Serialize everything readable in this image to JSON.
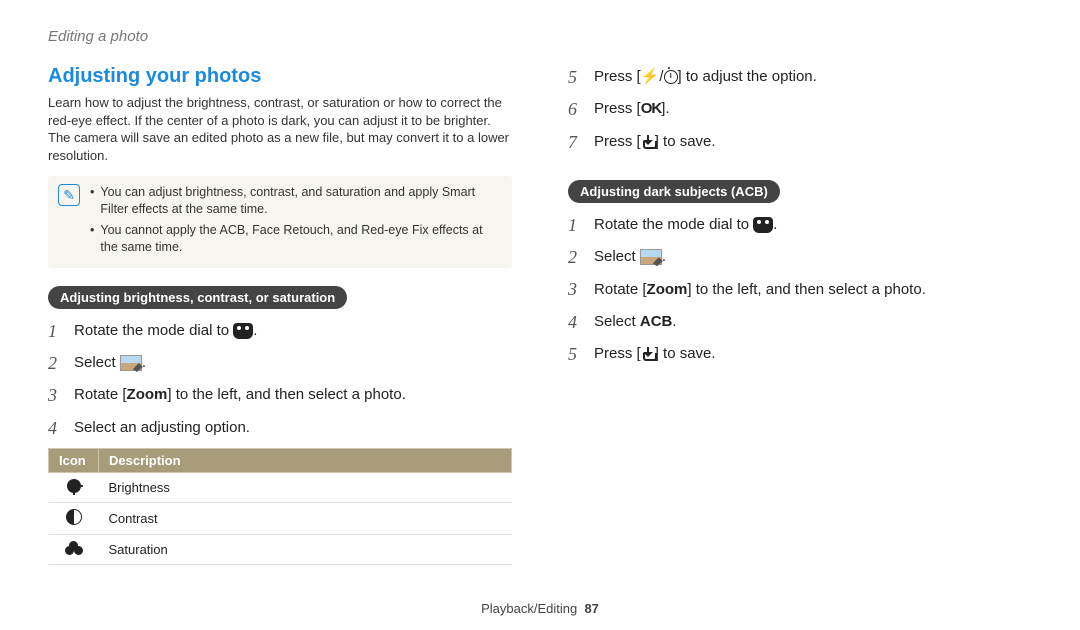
{
  "breadcrumb": "Editing a photo",
  "left": {
    "title": "Adjusting your photos",
    "intro": "Learn how to adjust the brightness, contrast, or saturation or how to correct the red-eye effect. If the center of a photo is dark, you can adjust it to be brighter. The camera will save an edited photo as a new file, but may convert it to a lower resolution.",
    "note1": "You can adjust brightness, contrast, and saturation and apply Smart Filter effects at the same time.",
    "note2": "You cannot apply the ACB, Face Retouch, and Red-eye Fix effects at the same time.",
    "pill": "Adjusting brightness, contrast, or saturation",
    "steps": {
      "s1a": "Rotate the mode dial to ",
      "s1b": ".",
      "s2a": "Select ",
      "s2b": ".",
      "s3a": "Rotate [",
      "s3b": "Zoom",
      "s3c": "] to the left, and then select a photo.",
      "s4": "Select an adjusting option."
    },
    "table": {
      "h1": "Icon",
      "h2": "Description",
      "r1": "Brightness",
      "r2": "Contrast",
      "r3": "Saturation"
    }
  },
  "right": {
    "steps_top": {
      "s5a": "Press [",
      "s5b": "/",
      "s5c": "] to adjust the option.",
      "s6a": "Press [",
      "s6b": "].",
      "s7a": "Press [",
      "s7b": "] to save."
    },
    "pill": "Adjusting dark subjects (ACB)",
    "steps_acb": {
      "s1a": "Rotate the mode dial to ",
      "s1b": ".",
      "s2a": "Select ",
      "s2b": ".",
      "s3a": "Rotate [",
      "s3b": "Zoom",
      "s3c": "] to the left, and then select a photo.",
      "s4a": "Select ",
      "s4b": "ACB",
      "s4c": ".",
      "s5a": "Press [",
      "s5b": "] to save."
    }
  },
  "footer": {
    "section": "Playback/Editing",
    "page": "87"
  },
  "nums": {
    "n1": "1",
    "n2": "2",
    "n3": "3",
    "n4": "4",
    "n5": "5",
    "n6": "6",
    "n7": "7"
  },
  "ok_label": "OK",
  "flash_glyph": "⚡"
}
